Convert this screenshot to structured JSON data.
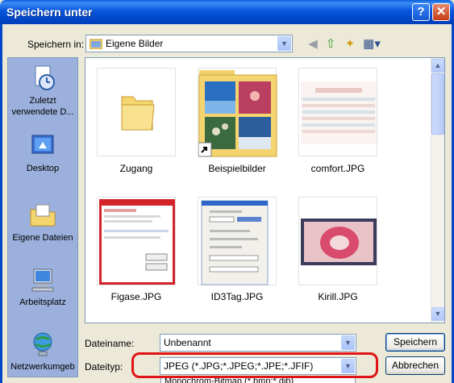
{
  "window": {
    "title": "Speichern unter",
    "help_label": "?",
    "close_label": "✕"
  },
  "save_in": {
    "label": "Speichern in:",
    "value": "Eigene Bilder"
  },
  "toolbar": {
    "icons": [
      "back-icon",
      "up-folder-icon",
      "new-folder-icon",
      "view-menu-icon"
    ]
  },
  "places": [
    {
      "label": "Zuletzt verwendete D...",
      "icon": "recent-documents-icon"
    },
    {
      "label": "Desktop",
      "icon": "desktop-icon"
    },
    {
      "label": "Eigene Dateien",
      "icon": "my-documents-icon"
    },
    {
      "label": "Arbeitsplatz",
      "icon": "my-computer-icon"
    },
    {
      "label": "Netzwerkumgeb",
      "icon": "network-icon"
    }
  ],
  "files": [
    {
      "name": "Zugang",
      "kind": "folder"
    },
    {
      "name": "Beispielbilder",
      "kind": "folder-shortcut"
    },
    {
      "name": "comfort.JPG",
      "kind": "image"
    },
    {
      "name": "Figase.JPG",
      "kind": "image"
    },
    {
      "name": "ID3Tag.JPG",
      "kind": "image"
    },
    {
      "name": "Kirill.JPG",
      "kind": "image"
    }
  ],
  "filename": {
    "label": "Dateiname:",
    "value": "Unbenannt"
  },
  "filetype": {
    "label": "Dateityp:",
    "value": "JPEG (*.JPG;*.JPEG;*.JPE;*.JFIF)",
    "next_option": "Monochrom-Bitmap (*.bmp;*.dib)"
  },
  "buttons": {
    "save": "Speichern",
    "cancel": "Abbrechen"
  },
  "colors": {
    "titlebar": "#0046c8",
    "highlight": "#e01515",
    "places_bg": "#9bb0dc"
  }
}
